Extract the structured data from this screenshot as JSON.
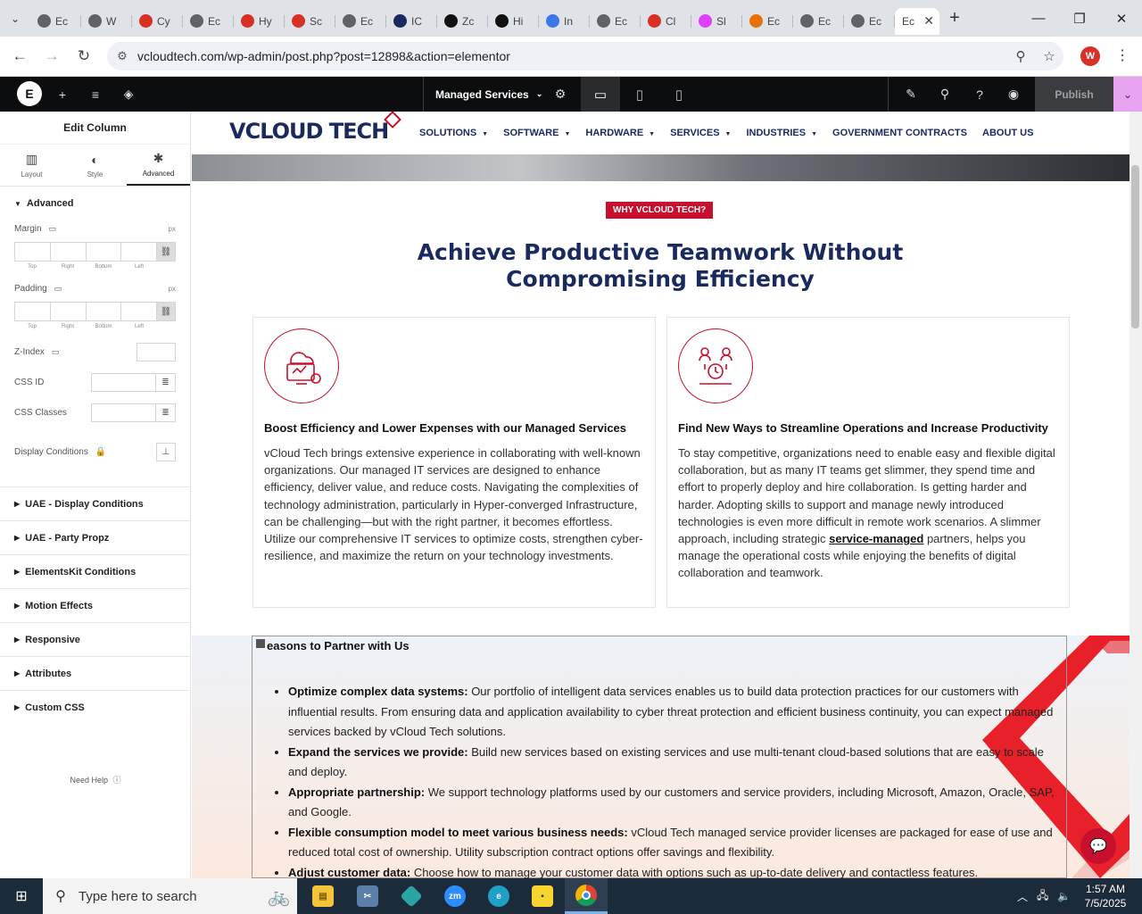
{
  "browser": {
    "tabs": [
      {
        "label": "Ec",
        "color": "#5f6368"
      },
      {
        "label": "W",
        "color": "#5f6368"
      },
      {
        "label": "Cy",
        "color": "#d93025"
      },
      {
        "label": "Ec",
        "color": "#5f6368"
      },
      {
        "label": "Hy",
        "color": "#d93025"
      },
      {
        "label": "Sc",
        "color": "#d93025"
      },
      {
        "label": "Ec",
        "color": "#5f6368"
      },
      {
        "label": "IC",
        "color": "#1a2a5e"
      },
      {
        "label": "Zc",
        "color": "#111111"
      },
      {
        "label": "Hi",
        "color": "#111111"
      },
      {
        "label": "In",
        "color": "#3b78e7"
      },
      {
        "label": "Ec",
        "color": "#5f6368"
      },
      {
        "label": "Cl",
        "color": "#d93025"
      },
      {
        "label": "Sl",
        "color": "#e040fb"
      },
      {
        "label": "Ec",
        "color": "#e8710a"
      },
      {
        "label": "Ec",
        "color": "#5f6368"
      },
      {
        "label": "Ec",
        "color": "#5f6368"
      }
    ],
    "active_tab": {
      "label": "Ec"
    },
    "url": "vcloudtech.com/wp-admin/post.php?post=12898&action=elementor",
    "profile_initial": "W"
  },
  "elementor": {
    "page_selector": "Managed Services",
    "publish_label": "Publish",
    "panel": {
      "title": "Edit Column",
      "tabs": [
        {
          "label": "Layout",
          "icon": "▥"
        },
        {
          "label": "Style",
          "icon": "◐"
        },
        {
          "label": "Advanced",
          "icon": "✱"
        }
      ],
      "section_title": "Advanced",
      "margin_label": "Margin",
      "padding_label": "Padding",
      "unit": "px",
      "sides": [
        "Top",
        "Right",
        "Bottom",
        "Left"
      ],
      "zindex_label": "Z-Index",
      "cssid_label": "CSS ID",
      "cssclasses_label": "CSS Classes",
      "display_conditions_label": "Display Conditions",
      "accordions": [
        "UAE - Display Conditions",
        "UAE - Party Propz",
        "ElementsKit Conditions",
        "Motion Effects",
        "Responsive",
        "Attributes",
        "Custom CSS"
      ],
      "need_help": "Need Help"
    }
  },
  "site": {
    "logo_text": "VCLOUD TECH",
    "nav": [
      {
        "label": "SOLUTIONS",
        "dropdown": true
      },
      {
        "label": "SOFTWARE",
        "dropdown": true
      },
      {
        "label": "HARDWARE",
        "dropdown": true
      },
      {
        "label": "SERVICES",
        "dropdown": true
      },
      {
        "label": "INDUSTRIES",
        "dropdown": true
      },
      {
        "label": "GOVERNMENT CONTRACTS",
        "dropdown": false
      },
      {
        "label": "ABOUT US",
        "dropdown": false
      }
    ],
    "badge": "WHY VCLOUD TECH?",
    "title_line1": "Achieve Productive Teamwork Without",
    "title_line2": "Compromising Efficiency",
    "cards": [
      {
        "heading": "Boost Efficiency and Lower Expenses with our Managed Services",
        "body": "vCloud Tech brings extensive experience in collaborating with well-known organizations. Our managed IT services are designed to enhance efficiency, deliver value, and reduce costs. Navigating the complexities of technology administration, particularly in Hyper-converged Infrastructure, can be challenging—but with the right partner, it becomes effortless. Utilize our comprehensive IT services to optimize costs, strengthen cyber-resilience, and maximize the return on your technology investments."
      },
      {
        "heading": "Find New Ways to Streamline Operations and Increase Productivity",
        "body_before": "To stay competitive, organizations need to enable easy and flexible digital collaboration, but as many IT teams get slimmer, they spend time and effort to properly deploy and hire collaboration. Is getting harder and harder. Adopting skills to support and manage newly introduced technologies is even more difficult in remote work scenarios. A slimmer approach, including strategic ",
        "link": "service-managed",
        "body_after": " partners, helps you manage the operational costs while enjoying the benefits of digital collaboration and teamwork."
      }
    ],
    "reasons_title": "easons to Partner with Us",
    "reasons": [
      {
        "bold": "Optimize complex data systems:",
        "text": " Our portfolio of intelligent data services enables us to build data protection practices for our customers with influential results. From ensuring data and application availability to cyber threat protection and efficient business continuity, you can expect managed services backed by vCloud Tech solutions."
      },
      {
        "bold": "Expand the services we provide:",
        "text": " Build new services based on existing services and use multi-tenant cloud-based solutions that are easy to scale and deploy."
      },
      {
        "bold": "Appropriate partnership:",
        "text": " We support technology platforms used by our customers and service providers, including Microsoft, Amazon, Oracle, SAP, and Google."
      },
      {
        "bold": "Flexible consumption model to meet various business needs:",
        "text": " vCloud Tech managed service provider licenses are packaged for ease of use and reduced total cost of ownership. Utility subscription contract options offer savings and flexibility."
      },
      {
        "bold": "Adjust customer data:",
        "text": " Choose how to manage your customer data with options such as up-to-date delivery and contactless features."
      }
    ]
  },
  "taskbar": {
    "search_placeholder": "Type here to search",
    "time": "1:57 AM",
    "date": "7/5/2025"
  },
  "colors": {
    "brand_red": "#c8102e",
    "brand_navy": "#1a2a5e",
    "publish_dd": "#e8a4f0"
  }
}
